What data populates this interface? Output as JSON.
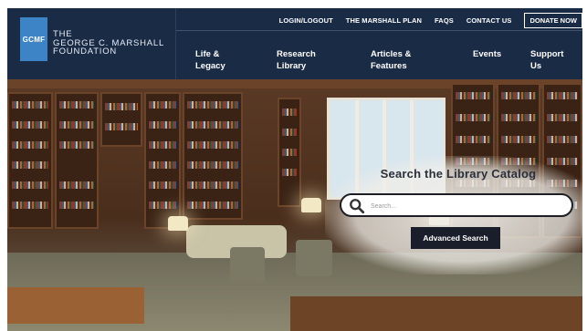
{
  "logo": {
    "mark": "GCMF",
    "line1": "THE",
    "line2": "GEORGE C. MARSHALL",
    "line3": "FOUNDATION"
  },
  "util_nav": {
    "login": "LOGIN/LOGOUT",
    "plan": "THE MARSHALL PLAN",
    "faqs": "FAQS",
    "contact": "CONTACT US",
    "donate": "DONATE NOW"
  },
  "main_nav": [
    {
      "line1": "Life &",
      "line2": "Legacy"
    },
    {
      "line1": "Research",
      "line2": "Library"
    },
    {
      "line1": "Articles &",
      "line2": "Features"
    },
    {
      "line1": "Events",
      "line2": ""
    },
    {
      "line1": "Support",
      "line2": "Us"
    }
  ],
  "search": {
    "title": "Search the Library Catalog",
    "placeholder": "Search...",
    "button": "Advanced Search"
  },
  "colors": {
    "header_bg": "#1a2b45",
    "logo_accent": "#3d84c7",
    "button_bg": "#1a1e2a"
  }
}
